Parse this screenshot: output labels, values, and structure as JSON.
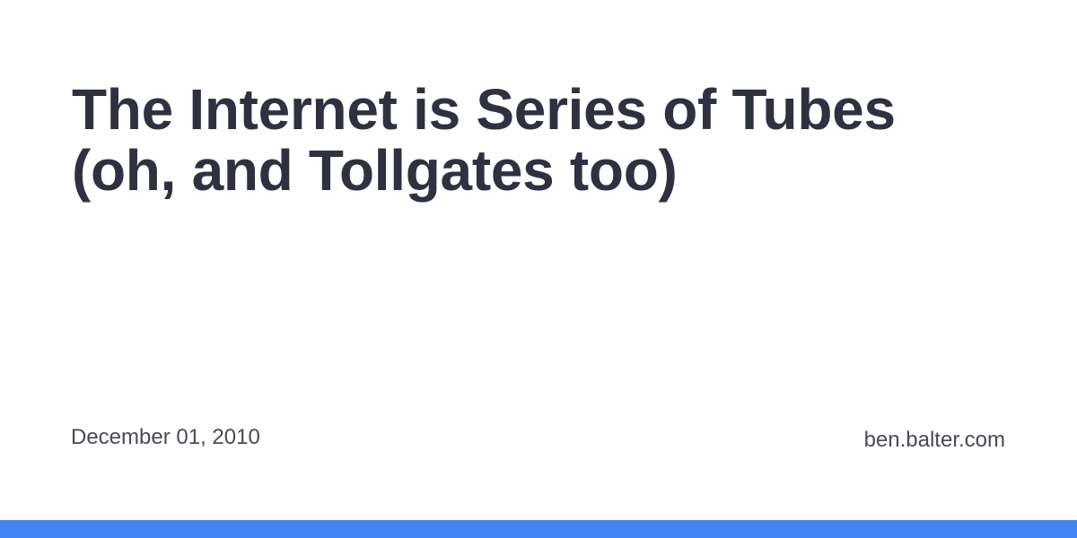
{
  "post": {
    "title": "The Internet is Series of Tubes (oh, and Tollgates too)",
    "date": "December 01, 2010",
    "site": "ben.balter.com"
  },
  "theme": {
    "accent_color": "#4285f4",
    "text_color": "#2f3140",
    "meta_color": "#4a4b55",
    "background": "#ffffff"
  }
}
